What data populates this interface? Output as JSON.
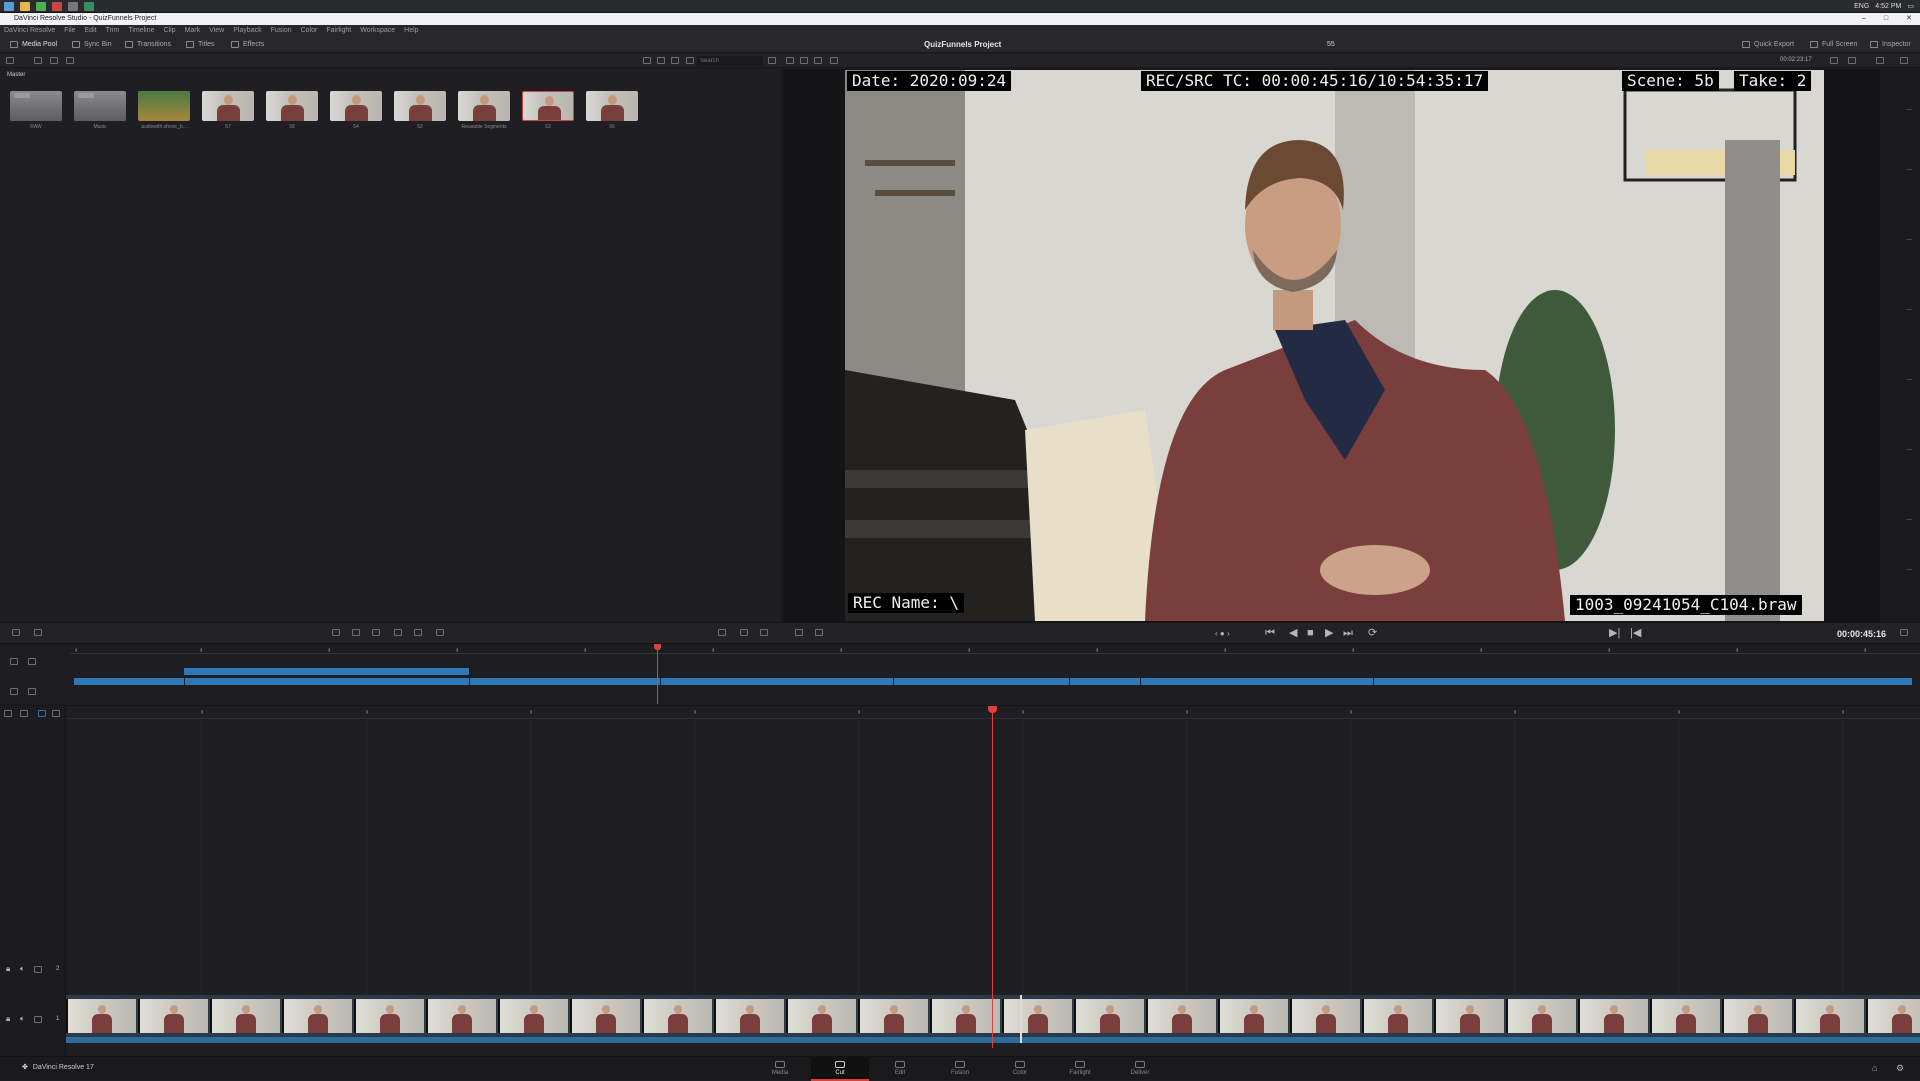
{
  "window": {
    "title": "DaVinci Resolve Studio - QuizFunnels Project"
  },
  "os": {
    "tray_lang": "ENG",
    "tray_time": "4:52 PM"
  },
  "menu": [
    "DaVinci Resolve",
    "File",
    "Edit",
    "Trim",
    "Timeline",
    "Clip",
    "Mark",
    "View",
    "Playback",
    "Fusion",
    "Color",
    "Fairlight",
    "Workspace",
    "Help"
  ],
  "toolbar": {
    "media_pool": "Media Pool",
    "sync_bin": "Sync Bin",
    "transitions": "Transitions",
    "titles": "Titles",
    "effects": "Effects",
    "project_title": "QuizFunnels Project",
    "quick_export": "Quick Export",
    "full_screen": "Full Screen",
    "inspector": "Inspector",
    "viewer_clip": "55"
  },
  "sub_toolbar": {
    "search_placeholder": "Search",
    "duration": "00:02:23:17"
  },
  "media_pool": {
    "bin": "Master",
    "clips": [
      {
        "label": "RAW",
        "kind": "folder"
      },
      {
        "label": "Music",
        "kind": "folder"
      },
      {
        "label": "audiowith.shove_b...",
        "kind": "audio"
      },
      {
        "label": "57",
        "kind": "person"
      },
      {
        "label": "58",
        "kind": "person"
      },
      {
        "label": "54",
        "kind": "person"
      },
      {
        "label": "52",
        "kind": "person"
      },
      {
        "label": "Reusable Segments",
        "kind": "person"
      },
      {
        "label": "53",
        "kind": "person"
      },
      {
        "label": "56",
        "kind": "person"
      }
    ]
  },
  "viewer": {
    "date": "Date: 2020:09:24",
    "rec_src_tc": "REC/SRC TC: 00:00:45:16/10:54:35:17",
    "scene": "Scene: 5b",
    "take": "Take: 2",
    "rec_name": "REC Name: \\",
    "filename": "1003_09241054_C104.braw"
  },
  "transport": {
    "timecode": "00:00:45:16"
  },
  "colors": {
    "accent_blue": "#2e78b7",
    "playhead_red": "#e0403a",
    "panel": "#1f1f23"
  },
  "pages": [
    {
      "name": "Media"
    },
    {
      "name": "Cut"
    },
    {
      "name": "Edit"
    },
    {
      "name": "Fusion"
    },
    {
      "name": "Color"
    },
    {
      "name": "Fairlight"
    },
    {
      "name": "Deliver"
    }
  ],
  "app_badge": "DaVinci Resolve 17"
}
